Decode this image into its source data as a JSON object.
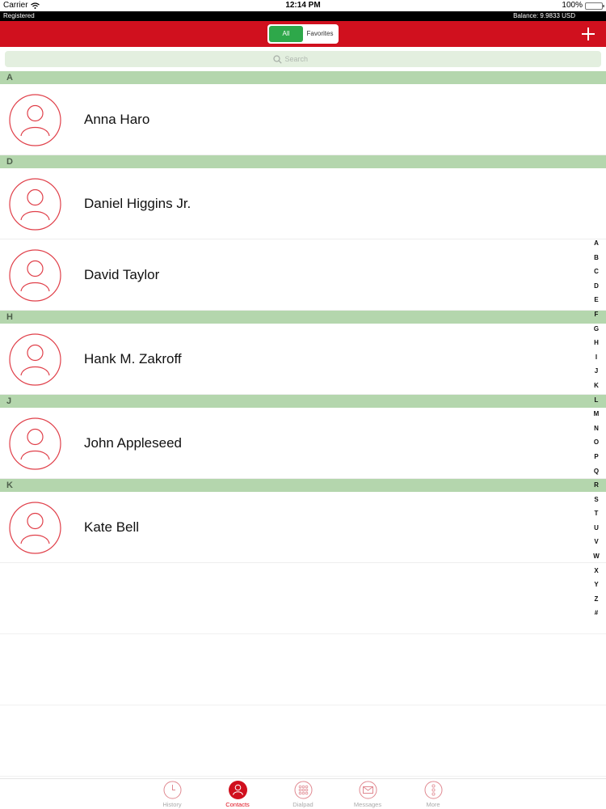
{
  "status_bar": {
    "carrier": "Carrier",
    "time": "12:14 PM",
    "battery": "100%"
  },
  "account_bar": {
    "status": "Registered",
    "balance": "Balance: 9.9833 USD"
  },
  "nav": {
    "segments": [
      "All",
      "Favorites"
    ],
    "selected": "All"
  },
  "search": {
    "placeholder": "Search"
  },
  "sections": [
    {
      "letter": "A",
      "contacts": [
        "Anna Haro"
      ]
    },
    {
      "letter": "D",
      "contacts": [
        "Daniel Higgins Jr.",
        "David Taylor"
      ]
    },
    {
      "letter": "H",
      "contacts": [
        "Hank M. Zakroff"
      ]
    },
    {
      "letter": "J",
      "contacts": [
        "John Appleseed"
      ]
    },
    {
      "letter": "K",
      "contacts": [
        "Kate Bell"
      ]
    }
  ],
  "index_letters": [
    "A",
    "B",
    "C",
    "D",
    "E",
    "F",
    "G",
    "H",
    "I",
    "J",
    "K",
    "L",
    "M",
    "N",
    "O",
    "P",
    "Q",
    "R",
    "S",
    "T",
    "U",
    "V",
    "W",
    "X",
    "Y",
    "Z",
    "#"
  ],
  "tabs": [
    {
      "label": "History",
      "icon": "clock-icon"
    },
    {
      "label": "Contacts",
      "icon": "person-icon",
      "active": true
    },
    {
      "label": "Dialpad",
      "icon": "dialpad-icon"
    },
    {
      "label": "Messages",
      "icon": "envelope-icon"
    },
    {
      "label": "More",
      "icon": "more-icon"
    }
  ],
  "colors": {
    "brand_red": "#d0101e",
    "accent_green": "#2ea84a",
    "section_green": "#b4d6ad",
    "avatar_red": "#e0404a"
  }
}
